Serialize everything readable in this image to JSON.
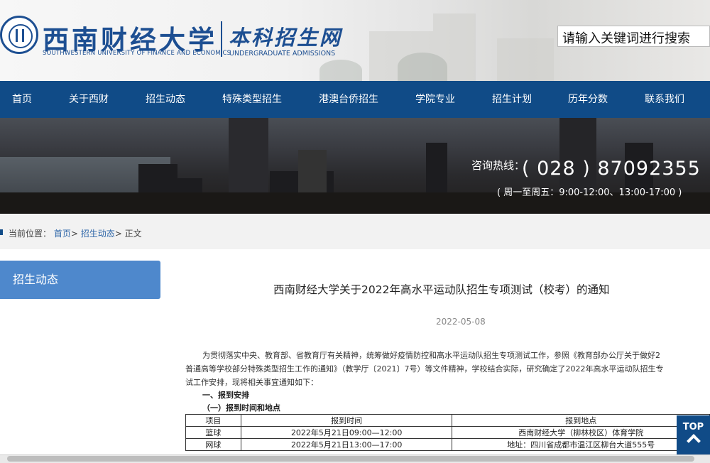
{
  "header": {
    "university_cn": "西南财经大学",
    "university_en": "SOUTHWESTERN UNIVERSITY OF FINANCE AND ECONOMICS",
    "site_cn": "本科招生网",
    "site_en": "UNDERGRADUATE ADMISSIONS",
    "search_placeholder": "请输入关键词进行搜索"
  },
  "nav": [
    "首页",
    "关于西财",
    "招生动态",
    "特殊类型招生",
    "港澳台侨招生",
    "学院专业",
    "招生计划",
    "历年分数",
    "联系我们"
  ],
  "banner": {
    "hotline_label": "咨询热线：",
    "hotline_number": "( 028 ) 87092355",
    "hours": "( 周一至周五：9:00-12:00、13:00-17:00 )"
  },
  "breadcrumb": {
    "prefix": "当前位置：",
    "items": [
      "首页",
      "招生动态",
      "正文"
    ],
    "sep": ">"
  },
  "sidebar": {
    "active": "招生动态"
  },
  "article": {
    "title": "西南财经大学关于2022年高水平运动队招生专项测试（校考）的通知",
    "date": "2022-05-08",
    "lines": [
      "为贯彻落实中央、教育部、省教育厅有关精神，统筹做好疫情防控和高水平运动队招生专项测试工作，参照《教育部办公厅关于做好2",
      "普通高等学校部分特殊类型招生工作的通知》（教学厅〔2021〕7号）等文件精神，学校结合实际，研究确定了2022年高水平运动队招生专",
      "试工作安排，现将相关事宜通知如下："
    ],
    "section1": "一、报到安排",
    "section1_1": "（一）报到时间和地点"
  },
  "table": {
    "headers": [
      "项目",
      "报到时间",
      "报到地点"
    ],
    "rows": [
      [
        "篮球",
        "2022年5月21日09:00—12:00",
        "西南财经大学（柳林校区）体育学院"
      ],
      [
        "网球",
        "2022年5月21日13:00—17:00",
        "地址：四川省成都市温江区柳台大道555号"
      ]
    ]
  },
  "top_button": "TOP",
  "colors": {
    "nav": "#104b87",
    "sidebar_active": "#4e88cc",
    "brand": "#1d4f92"
  }
}
